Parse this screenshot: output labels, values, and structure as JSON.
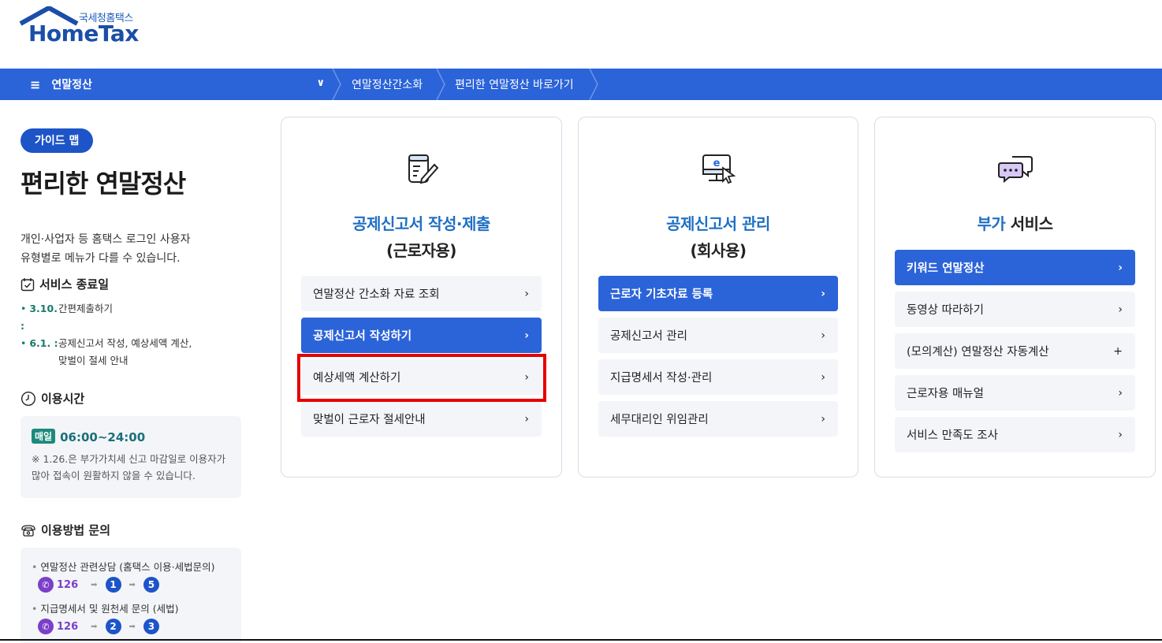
{
  "logo": {
    "korean": "국세청홈택스",
    "english": "HomeTax"
  },
  "nav": {
    "menu_label": "연말정산",
    "crumbs": [
      "연말정산간소화",
      "편리한 연말정산 바로가기"
    ]
  },
  "left": {
    "guide_label": "가이드 맵",
    "title": "편리한 연말정산",
    "desc_line1": "개인·사업자 등 홈택스 로그인 사용자",
    "desc_line2": "유형별로 메뉴가 다를 수 있습니다.",
    "service_end": {
      "title": "서비스 종료일",
      "items": [
        {
          "date": "3.10. :",
          "text": "간편제출하기"
        },
        {
          "date": "6.1. :",
          "text": "공제신고서 작성, 예상세액 계산,",
          "text2": "맞벌이 절세 안내"
        }
      ]
    },
    "usage_time": {
      "title": "이용시간",
      "daily": "매일",
      "hours": "06:00~24:00",
      "note": "※ 1.26.은 부가가치세 신고 마감일로 이용자가 많아 접속이 원활하지 않을 수 있습니다."
    },
    "inquiry": {
      "title": "이용방법 문의",
      "lines": [
        {
          "text": "연말정산 관련상담 (홈택스 이용·세법문의)",
          "number": "126",
          "steps": [
            "1",
            "5"
          ]
        },
        {
          "text": "지급명세서 및 원천세 문의 (세법)",
          "number": "126",
          "steps": [
            "2",
            "3"
          ]
        }
      ]
    }
  },
  "cards": [
    {
      "title1": "공제신고서 작성·제출",
      "title2": "(근로자용)",
      "items": [
        {
          "label": "연말정산 간소화 자료 조회",
          "active": false,
          "sign": "›"
        },
        {
          "label": "공제신고서 작성하기",
          "active": true,
          "sign": "›"
        },
        {
          "label": "예상세액 계산하기",
          "active": false,
          "sign": "›"
        },
        {
          "label": "맞벌이 근로자 절세안내",
          "active": false,
          "sign": "›"
        }
      ]
    },
    {
      "title1": "공제신고서 관리",
      "title2": "(회사용)",
      "items": [
        {
          "label": "근로자 기초자료 등록",
          "active": true,
          "sign": "›"
        },
        {
          "label": "공제신고서 관리",
          "active": false,
          "sign": "›"
        },
        {
          "label": "지급명세서 작성·관리",
          "active": false,
          "sign": "›"
        },
        {
          "label": "세무대리인 위임관리",
          "active": false,
          "sign": "›"
        }
      ]
    },
    {
      "title1a": "부가",
      "title1b": "서비스",
      "items": [
        {
          "label": "키워드 연말정산",
          "active": true,
          "sign": "›"
        },
        {
          "label": "동영상 따라하기",
          "active": false,
          "sign": "›"
        },
        {
          "label": "(모의계산) 연말정산 자동계산",
          "active": false,
          "sign": "+"
        },
        {
          "label": "근로자용 매뉴얼",
          "active": false,
          "sign": "›"
        },
        {
          "label": "서비스 만족도 조사",
          "active": false,
          "sign": "›"
        }
      ]
    }
  ],
  "colors": {
    "primary": "#2b63d9",
    "teal": "#1b8a7c",
    "highlight": "#e60000"
  }
}
